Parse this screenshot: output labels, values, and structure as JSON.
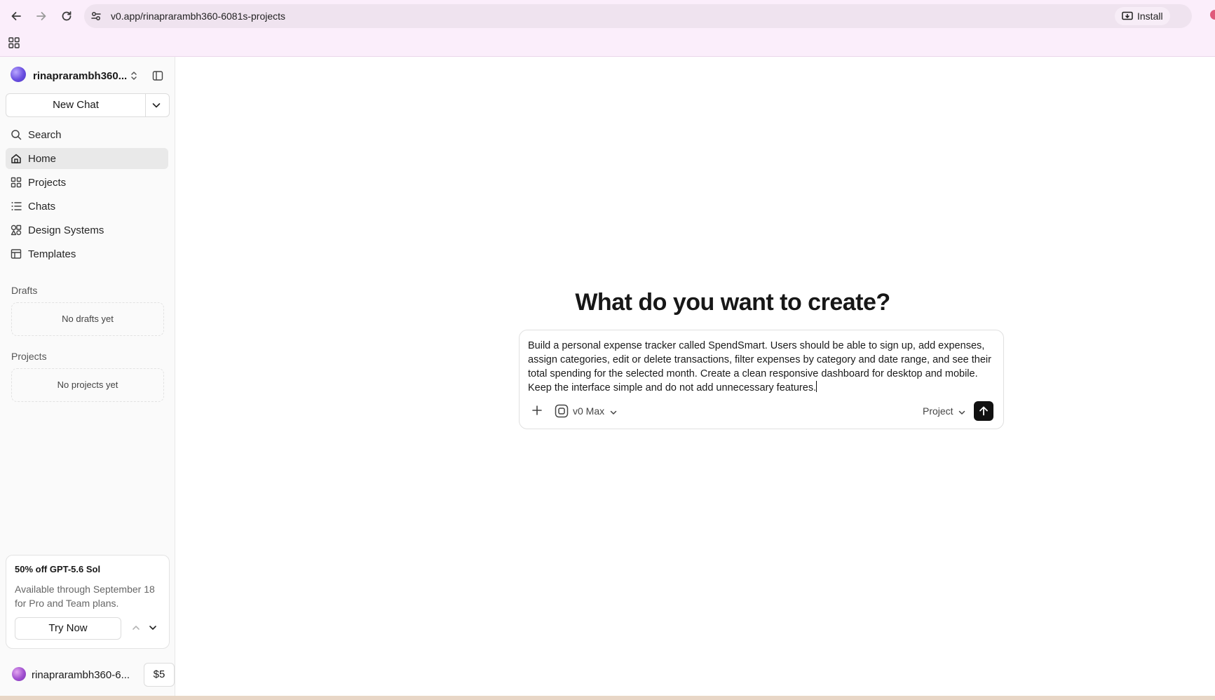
{
  "browser": {
    "url": "v0.app/rinaprarambh360-6081s-projects",
    "install_label": "Install"
  },
  "sidebar": {
    "account_name": "rinaprarambh360...",
    "new_chat_label": "New Chat",
    "nav": [
      {
        "label": "Search",
        "icon": "search-icon"
      },
      {
        "label": "Home",
        "icon": "home-icon"
      },
      {
        "label": "Projects",
        "icon": "grid-icon"
      },
      {
        "label": "Chats",
        "icon": "list-icon"
      },
      {
        "label": "Design Systems",
        "icon": "design-systems-icon"
      },
      {
        "label": "Templates",
        "icon": "templates-icon"
      }
    ],
    "drafts_title": "Drafts",
    "drafts_empty": "No drafts yet",
    "projects_title": "Projects",
    "projects_empty": "No projects yet",
    "promo": {
      "title": "50% off GPT-5.6 Sol",
      "text": "Available through September 18 for Pro and Team plans.",
      "button": "Try Now"
    },
    "footer": {
      "account_name": "rinaprarambh360-6...",
      "credits": "$5"
    }
  },
  "main": {
    "headline": "What do you want to create?",
    "prompt_text": "Build a personal expense tracker called SpendSmart. Users should be able to sign up, add expenses, assign categories, edit or delete transactions, filter expenses by category and date range, and see their total spending for the selected month. Create a clean responsive dashboard for desktop and mobile. Keep the interface simple and do not add unnecessary features.",
    "model_label": "v0 Max",
    "project_label": "Project"
  }
}
